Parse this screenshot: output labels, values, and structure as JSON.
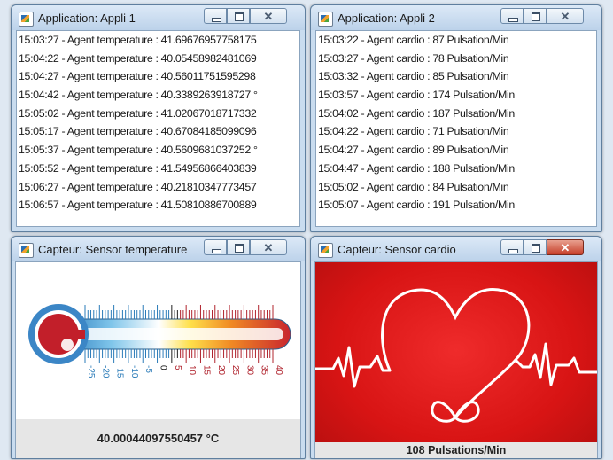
{
  "windows": {
    "appli1": {
      "title": "Application: Appli 1",
      "lines": [
        "15:03:27 - Agent temperature : 41.69676957758175",
        "15:04:22 - Agent temperature : 40.05458982481069",
        "15:04:27 - Agent temperature : 40.56011751595298",
        "15:04:42 - Agent temperature : 40.3389263918727 °",
        "15:05:02 - Agent temperature : 41.02067018717332",
        "15:05:17 - Agent temperature : 40.67084185099096",
        "15:05:37 - Agent temperature : 40.5609681037252 °",
        "15:05:52 - Agent temperature : 41.54956866403839",
        "15:06:27 - Agent temperature : 40.21810347773457",
        "15:06:57 - Agent temperature : 41.50810886700889"
      ]
    },
    "appli2": {
      "title": "Application: Appli 2",
      "lines": [
        "15:03:22 - Agent cardio : 87 Pulsation/Min",
        "15:03:27 - Agent cardio : 78 Pulsation/Min",
        "15:03:32 - Agent cardio : 85 Pulsation/Min",
        "15:03:57 - Agent cardio : 174 Pulsation/Min",
        "15:04:02 - Agent cardio : 187 Pulsation/Min",
        "15:04:22 - Agent cardio : 71 Pulsation/Min",
        "15:04:27 - Agent cardio : 89 Pulsation/Min",
        "15:04:47 - Agent cardio : 188 Pulsation/Min",
        "15:05:02 - Agent cardio : 84 Pulsation/Min",
        "15:05:07 - Agent cardio : 191 Pulsation/Min"
      ]
    },
    "sensor_temp": {
      "title": "Capteur: Sensor temperature",
      "reading": "40.00044097550457 °C",
      "scale_labels": [
        "-25",
        "-20",
        "-15",
        "-10",
        "-5",
        "0",
        "5",
        "10",
        "15",
        "20",
        "25",
        "30",
        "35",
        "40"
      ]
    },
    "sensor_cardio": {
      "title": "Capteur: Sensor cardio",
      "reading": "108 Pulsations/Min"
    }
  },
  "controls": {
    "close_glyph": "✕"
  }
}
